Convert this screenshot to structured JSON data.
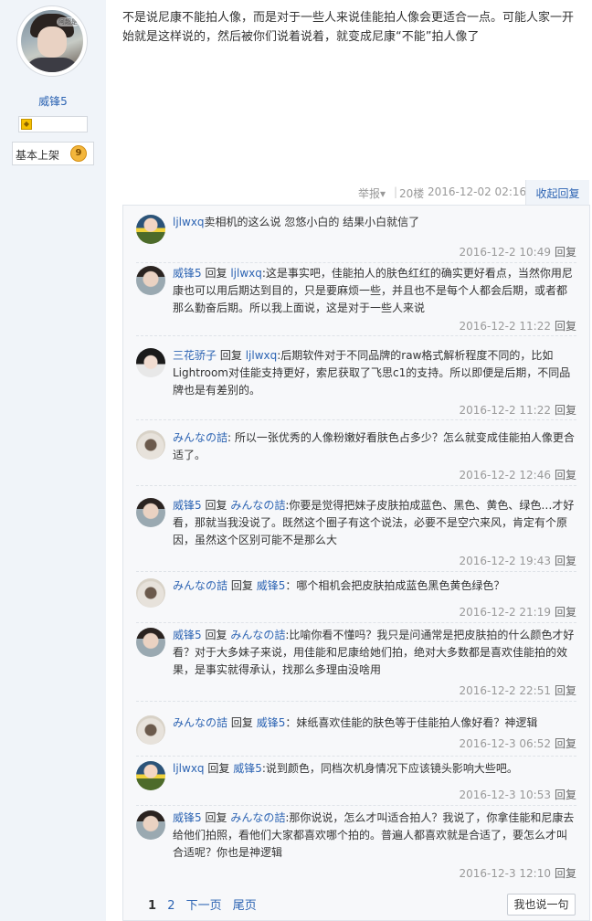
{
  "author": {
    "name": "威锋5",
    "avatar_tag": "阿超是",
    "rank_label": "基本上架",
    "rank_level": "9"
  },
  "post": {
    "content": "不是说尼康不能拍人像，而是对于一些人来说佳能拍人像会更适合一点。可能人家一开始就是这样说的，然后被你们说着说着，就变成尼康“不能”拍人像了",
    "report": "举报▾",
    "floor": "20楼",
    "date": "2016-12-02 02:16",
    "collapse_reply": "收起回复"
  },
  "comments": [
    {
      "user": "ljlwxq",
      "reply_prefix": "",
      "reply_to": "",
      "text": "卖相机的这么说 忽悠小白的 结果小白就信了",
      "time": "2016-12-2 10:49",
      "reply_label": "回复",
      "avatar": "av1"
    },
    {
      "user": "威锋5",
      "reply_prefix": "回复",
      "reply_to": "ljlwxq",
      "text": ":这是事实吧，佳能拍人的肤色红红的确实更好看点，当然你用尼康也可以用后期达到目的，只是要麻烦一些，并且也不是每个人都会后期，或者都那么勤奋后期。所以我上面说，这是对于一些人来说",
      "time": "2016-12-2 11:22",
      "reply_label": "回复",
      "avatar": "av2"
    },
    {
      "user": "三花骄子",
      "reply_prefix": "回复",
      "reply_to": "ljlwxq",
      "text": ":后期软件对于不同品牌的raw格式解析程度不同的，比如Lightroom对佳能支持更好，索尼获取了飞思c1的支持。所以即便是后期，不同品牌也是有差别的。",
      "time": "2016-12-2 11:22",
      "reply_label": "回复",
      "avatar": "av3"
    },
    {
      "user": "みんなの詰",
      "reply_prefix": "",
      "reply_to": "",
      "text": ": 所以一张优秀的人像粉嫩好看肤色占多少？怎么就变成佳能拍人像更合适了。",
      "time": "2016-12-2 12:46",
      "reply_label": "回复",
      "avatar": "av4"
    },
    {
      "user": "威锋5",
      "reply_prefix": "回复",
      "reply_to": "みんなの詰",
      "text": ":你要是觉得把妹子皮肤拍成蓝色、黑色、黄色、绿色…才好看，那就当我没说了。既然这个圈子有这个说法，必要不是空穴来风，肯定有个原因，虽然这个区别可能不是那么大",
      "time": "2016-12-2 19:43",
      "reply_label": "回复",
      "avatar": "av2"
    },
    {
      "user": "みんなの詰",
      "reply_prefix": "回复",
      "reply_to": "威锋5",
      "text": "：哪个相机会把皮肤拍成蓝色黑色黄色绿色？",
      "time": "2016-12-2 21:19",
      "reply_label": "回复",
      "avatar": "av4"
    },
    {
      "user": "威锋5",
      "reply_prefix": "回复",
      "reply_to": "みんなの詰",
      "text": ":比喻你看不懂吗？我只是问通常是把皮肤拍的什么颜色才好看？对于大多妹子来说，用佳能和尼康给她们拍，绝对大多数都是喜欢佳能拍的效果，是事实就得承认，找那么多理由没啥用",
      "time": "2016-12-2 22:51",
      "reply_label": "回复",
      "avatar": "av2"
    },
    {
      "user": "みんなの詰",
      "reply_prefix": "回复",
      "reply_to": "威锋5",
      "text": "：妹纸喜欢佳能的肤色等于佳能拍人像好看？神逻辑",
      "time": "2016-12-3 06:52",
      "reply_label": "回复",
      "avatar": "av4"
    },
    {
      "user": "ljlwxq",
      "reply_prefix": "回复",
      "reply_to": "威锋5",
      "text": ":说到颜色，同档次机身情况下应该镜头影响大些吧。",
      "time": "2016-12-3 10:53",
      "reply_label": "回复",
      "avatar": "av1"
    },
    {
      "user": "威锋5",
      "reply_prefix": "回复",
      "reply_to": "みんなの詰",
      "text": ":那你说说，怎么才叫适合拍人？我说了，你拿佳能和尼康去给他们拍照，看他们大家都喜欢哪个拍的。普遍人都喜欢就是合适了，要怎么才叫合适呢？你也是神逻辑",
      "time": "2016-12-3 12:10",
      "reply_label": "回复",
      "avatar": "av2"
    }
  ],
  "pager": {
    "current": "1",
    "page2": "2",
    "next": "下一页",
    "last": "尾页",
    "say_button": "我也说一句"
  }
}
